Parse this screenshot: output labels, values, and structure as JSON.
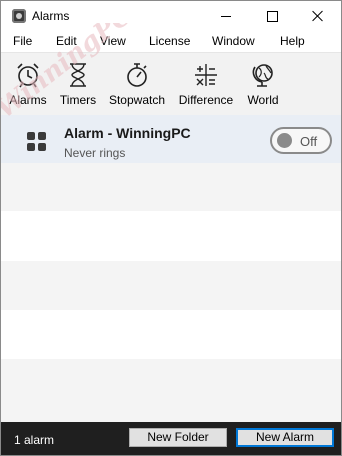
{
  "window": {
    "title": "Alarms"
  },
  "menu": [
    "File",
    "Edit",
    "View",
    "License",
    "Window",
    "Help"
  ],
  "watermark": "WinningPC",
  "toolbar": {
    "items": [
      {
        "label": "Alarms",
        "icon": "alarm-clock-icon"
      },
      {
        "label": "Timers",
        "icon": "hourglass-icon"
      },
      {
        "label": "Stopwatch",
        "icon": "stopwatch-icon"
      },
      {
        "label": "Difference",
        "icon": "calculator-icon"
      },
      {
        "label": "World",
        "icon": "globe-icon"
      }
    ]
  },
  "alarms": [
    {
      "title": "Alarm - WinningPC",
      "subtitle": "Never rings",
      "toggle": "Off"
    }
  ],
  "footer": {
    "count": "1 alarm",
    "new_folder": "New Folder",
    "new_alarm": "New Alarm"
  },
  "colors": {
    "alarm_row_bg": "#e9eef5",
    "footer_bg": "#1f1f1f",
    "accent": "#0078d7"
  }
}
